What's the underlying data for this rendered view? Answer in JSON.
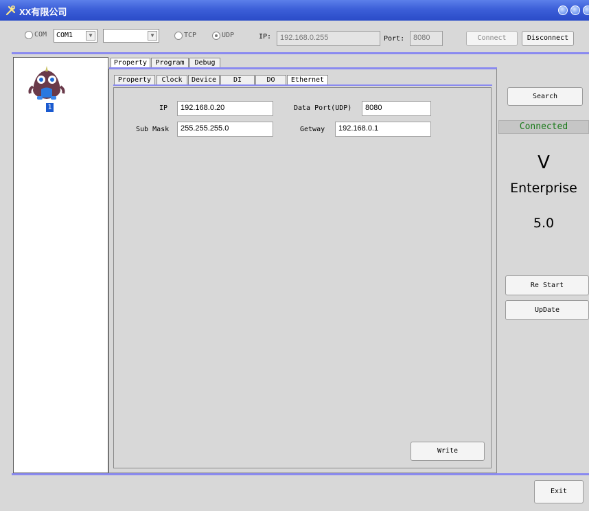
{
  "window": {
    "title": "XX有限公司"
  },
  "toolbar": {
    "com_label": "COM",
    "com_port": "COM1",
    "tcp_label": "TCP",
    "udp_label": "UDP",
    "ip_label": "IP:",
    "ip_value": "192.168.0.255",
    "port_label": "Port:",
    "port_value": "8080",
    "connect_label": "Connect",
    "disconnect_label": "Disconnect"
  },
  "devices": [
    {
      "label": "1"
    }
  ],
  "outer_tabs": [
    "Property",
    "Program",
    "Debug"
  ],
  "inner_tabs": [
    "Property",
    "Clock",
    "Device",
    "DI",
    "DO",
    "Ethernet"
  ],
  "ethernet": {
    "ip_label": "IP",
    "ip_value": "192.168.0.20",
    "data_port_label": "Data Port(UDP)",
    "data_port_value": "8080",
    "submask_label": "Sub Mask",
    "submask_value": "255.255.255.0",
    "gateway_label": "Getway",
    "gateway_value": "192.168.0.1",
    "write_label": "Write"
  },
  "side": {
    "search_label": "Search",
    "status": "Connected",
    "status_color": "#1a7a1a",
    "version_letter": "V",
    "edition": "Enterprise",
    "version_number": "5.0",
    "restart_label": "Re Start",
    "update_label": "UpDate",
    "exit_label": "Exit"
  },
  "accent": "#8a8af0"
}
